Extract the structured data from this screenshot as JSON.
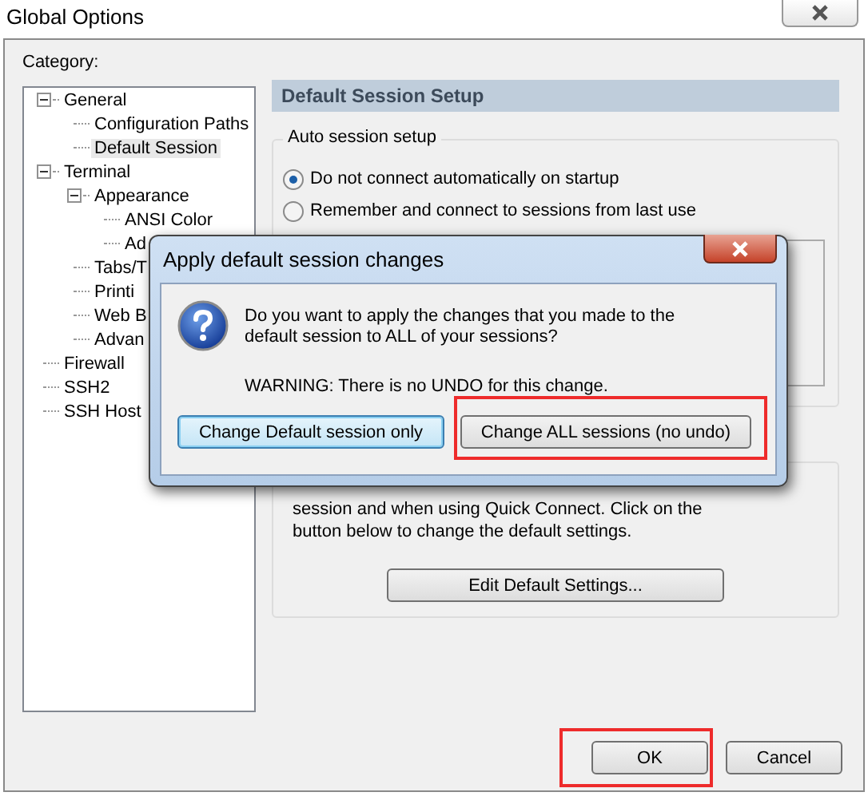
{
  "window": {
    "title": "Global Options"
  },
  "category_label": "Category:",
  "tree": [
    {
      "label": "General",
      "expanded": true,
      "selected": false,
      "children": [
        {
          "label": "Configuration Paths",
          "selected": false
        },
        {
          "label": "Default Session",
          "selected": true
        }
      ]
    },
    {
      "label": "Terminal",
      "expanded": true,
      "selected": false,
      "children": [
        {
          "label": "Appearance",
          "expanded": true,
          "selected": false,
          "children": [
            {
              "label": "ANSI Color",
              "selected": false
            },
            {
              "label": "Ad",
              "selected": false
            }
          ]
        },
        {
          "label": "Tabs/T",
          "selected": false
        },
        {
          "label": "Printi",
          "selected": false
        },
        {
          "label": "Web B",
          "selected": false
        },
        {
          "label": "Advan",
          "selected": false
        }
      ]
    },
    {
      "label": "Firewall",
      "selected": false
    },
    {
      "label": "SSH2",
      "selected": false
    },
    {
      "label": "SSH Host",
      "selected": false
    }
  ],
  "panel": {
    "header": "Default Session Setup",
    "auto_session": {
      "title": "Auto session setup",
      "options": [
        {
          "label": "Do not connect automatically on startup",
          "selected": true
        },
        {
          "label": "Remember and connect to sessions from last use",
          "selected": false
        }
      ]
    },
    "description_lines": [
      "session and when using Quick Connect.  Click on the",
      "button below to change the default settings."
    ],
    "edit_button": "Edit Default Settings..."
  },
  "buttons": [
    {
      "label": "OK",
      "highlighted": true
    },
    {
      "label": "Cancel",
      "highlighted": false
    }
  ],
  "dialog": {
    "title": "Apply default session changes",
    "message": "Do you want to apply the changes that you made to the default session to ALL of your sessions?",
    "warning": "WARNING: There is no UNDO for this change.",
    "buttons": [
      {
        "label": "Change Default session only",
        "default": true,
        "highlighted": false
      },
      {
        "label": "Change ALL sessions (no undo)",
        "default": false,
        "highlighted": true
      }
    ]
  }
}
